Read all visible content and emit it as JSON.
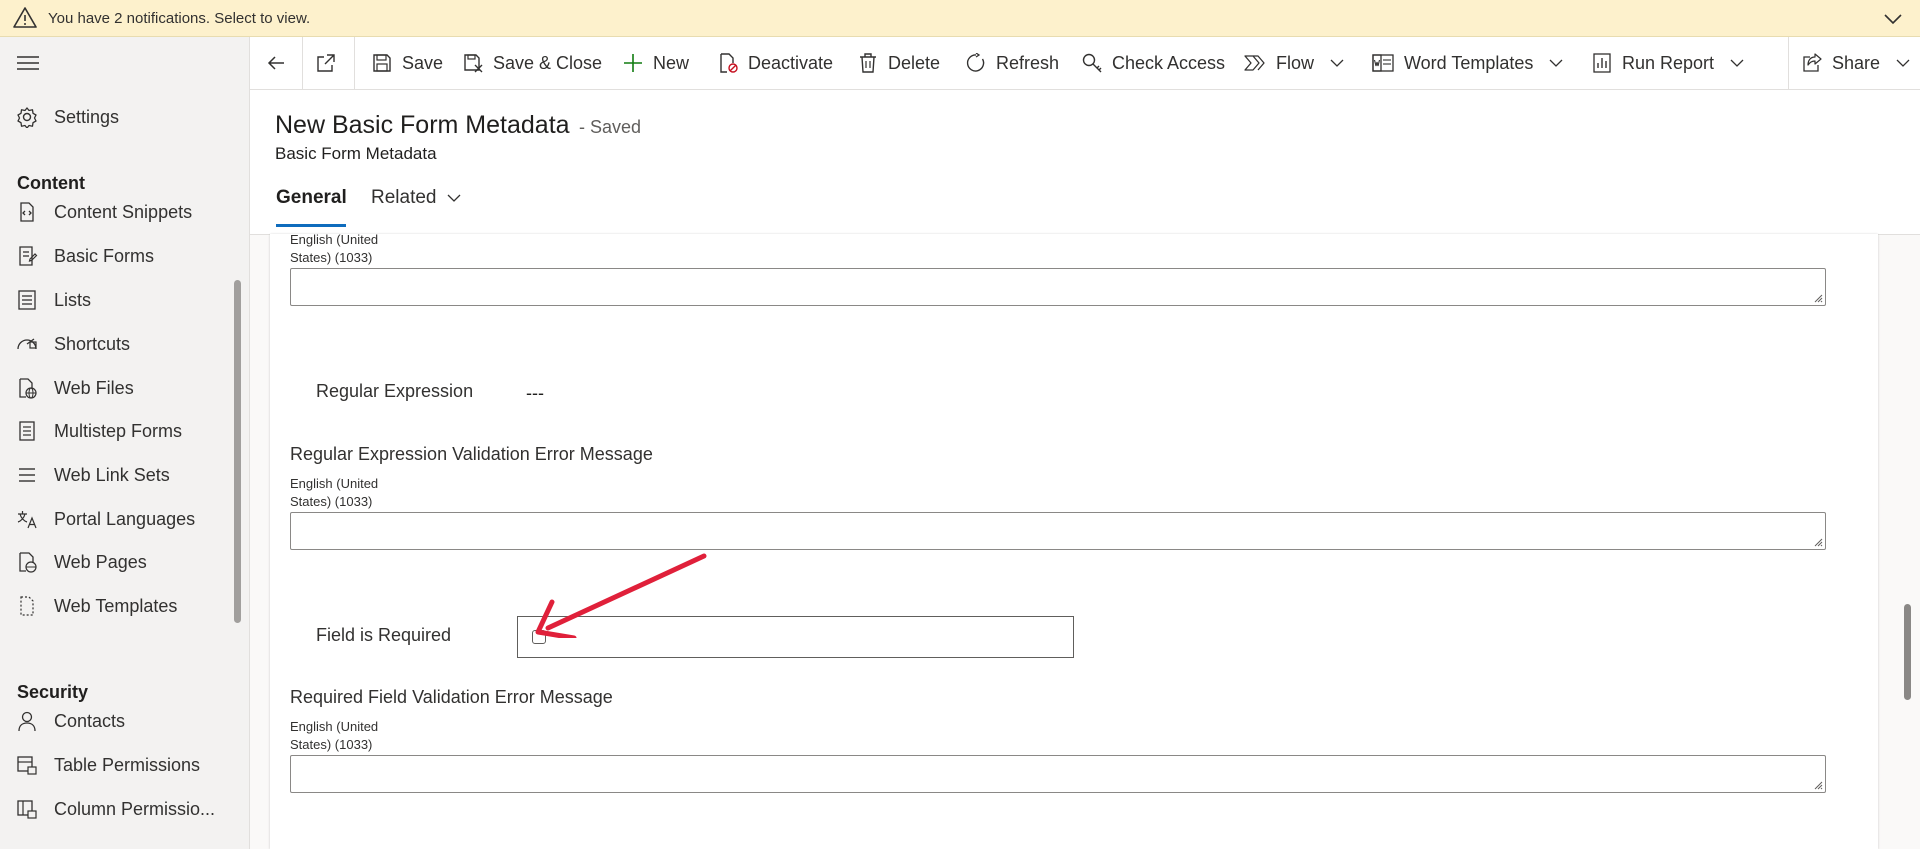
{
  "notification": {
    "text": "You have 2 notifications. Select to view."
  },
  "sidebar": {
    "settings_label": "Settings",
    "content_section": "Content",
    "content_items": [
      {
        "label": "Content Snippets",
        "icon": "content-snippets-icon"
      },
      {
        "label": "Basic Forms",
        "icon": "basic-forms-icon"
      },
      {
        "label": "Lists",
        "icon": "lists-icon"
      },
      {
        "label": "Shortcuts",
        "icon": "shortcuts-icon"
      },
      {
        "label": "Web Files",
        "icon": "web-files-icon"
      },
      {
        "label": "Multistep Forms",
        "icon": "multistep-forms-icon"
      },
      {
        "label": "Web Link Sets",
        "icon": "web-link-sets-icon"
      },
      {
        "label": "Portal Languages",
        "icon": "portal-languages-icon"
      },
      {
        "label": "Web Pages",
        "icon": "web-pages-icon"
      },
      {
        "label": "Web Templates",
        "icon": "web-templates-icon"
      }
    ],
    "security_section": "Security",
    "security_items": [
      {
        "label": "Contacts",
        "icon": "contacts-icon"
      },
      {
        "label": "Table Permissions",
        "icon": "table-permissions-icon"
      },
      {
        "label": "Column Permissio...",
        "icon": "column-permissions-icon"
      }
    ]
  },
  "commandbar": {
    "save": "Save",
    "save_close": "Save & Close",
    "new": "New",
    "deactivate": "Deactivate",
    "delete": "Delete",
    "refresh": "Refresh",
    "check_access": "Check Access",
    "flow": "Flow",
    "word_templates": "Word Templates",
    "run_report": "Run Report",
    "share": "Share"
  },
  "header": {
    "title": "New Basic Form Metadata",
    "status": "- Saved",
    "entity": "Basic Form Metadata",
    "tabs": [
      "General",
      "Related"
    ]
  },
  "form": {
    "lang_label": "English (United States) (1033)",
    "regex_label": "Regular Expression",
    "regex_value": "---",
    "regex_error_label": "Regular Expression Validation Error Message",
    "field_required_label": "Field is Required",
    "field_required_checked": false,
    "required_error_label": "Required Field Validation Error Message"
  },
  "colors": {
    "notification_bg": "#fdf1cc",
    "accent": "#0f6cbd",
    "annotation_arrow": "#e0203a"
  }
}
